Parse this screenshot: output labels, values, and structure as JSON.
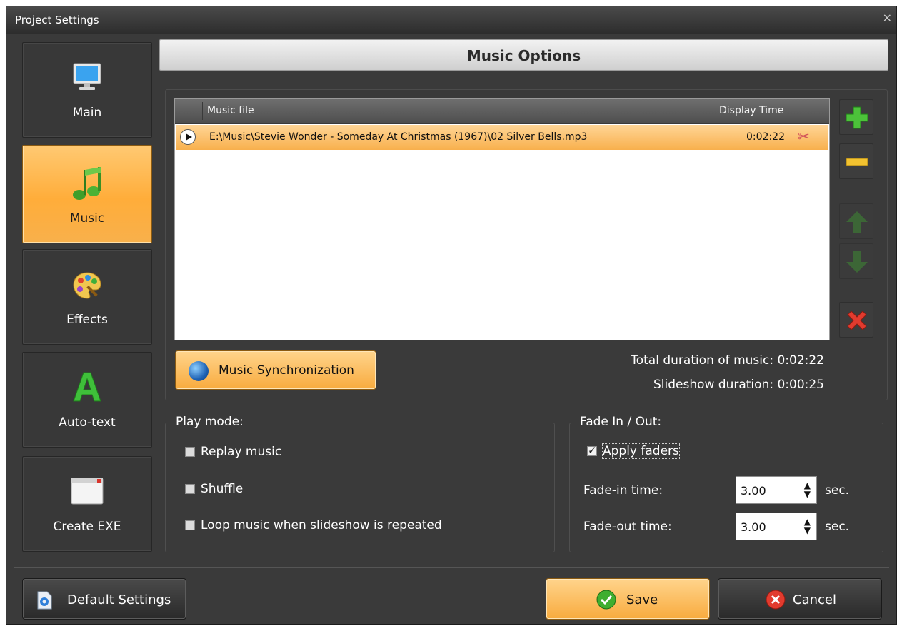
{
  "window": {
    "title": "Project Settings",
    "close_glyph": "×"
  },
  "sidebar": {
    "items": [
      {
        "label": "Main",
        "icon": "monitor-icon",
        "active": false
      },
      {
        "label": "Music",
        "icon": "music-note-icon",
        "active": true
      },
      {
        "label": "Effects",
        "icon": "palette-icon",
        "active": false
      },
      {
        "label": "Auto-text",
        "icon": "letter-a-icon",
        "active": false
      },
      {
        "label": "Create EXE",
        "icon": "window-icon",
        "active": false
      }
    ]
  },
  "header": {
    "title": "Music Options"
  },
  "music_list": {
    "columns": [
      "Music file",
      "Display Time"
    ],
    "rows": [
      {
        "file": "E:\\Music\\Stevie Wonder - Someday At Christmas (1967)\\02 Silver Bells.mp3",
        "time": "0:02:22",
        "selected": true
      }
    ]
  },
  "side_tools": [
    "add-icon",
    "remove-icon",
    "move-up-icon",
    "move-down-icon",
    "delete-icon"
  ],
  "sync_button": {
    "label": "Music Synchronization"
  },
  "durations": {
    "total": "Total duration of music: 0:02:22",
    "slideshow": "Slideshow duration: 0:00:25"
  },
  "play_mode": {
    "title": "Play mode:",
    "options": [
      {
        "label": "Replay music",
        "checked": false
      },
      {
        "label": "Shuffle",
        "checked": false
      },
      {
        "label": "Loop music when slideshow is repeated",
        "checked": false
      }
    ]
  },
  "fade": {
    "title": "Fade In / Out:",
    "apply_label": "Apply faders",
    "apply_checked": true,
    "fade_in_label": "Fade-in time:",
    "fade_in_value": "3.00",
    "fade_out_label": "Fade-out time:",
    "fade_out_value": "3.00",
    "unit": "sec."
  },
  "footer": {
    "default_label": "Default Settings",
    "save_label": "Save",
    "cancel_label": "Cancel"
  },
  "colors": {
    "accent": "#f8b04d",
    "panel": "#3a3a3a"
  }
}
